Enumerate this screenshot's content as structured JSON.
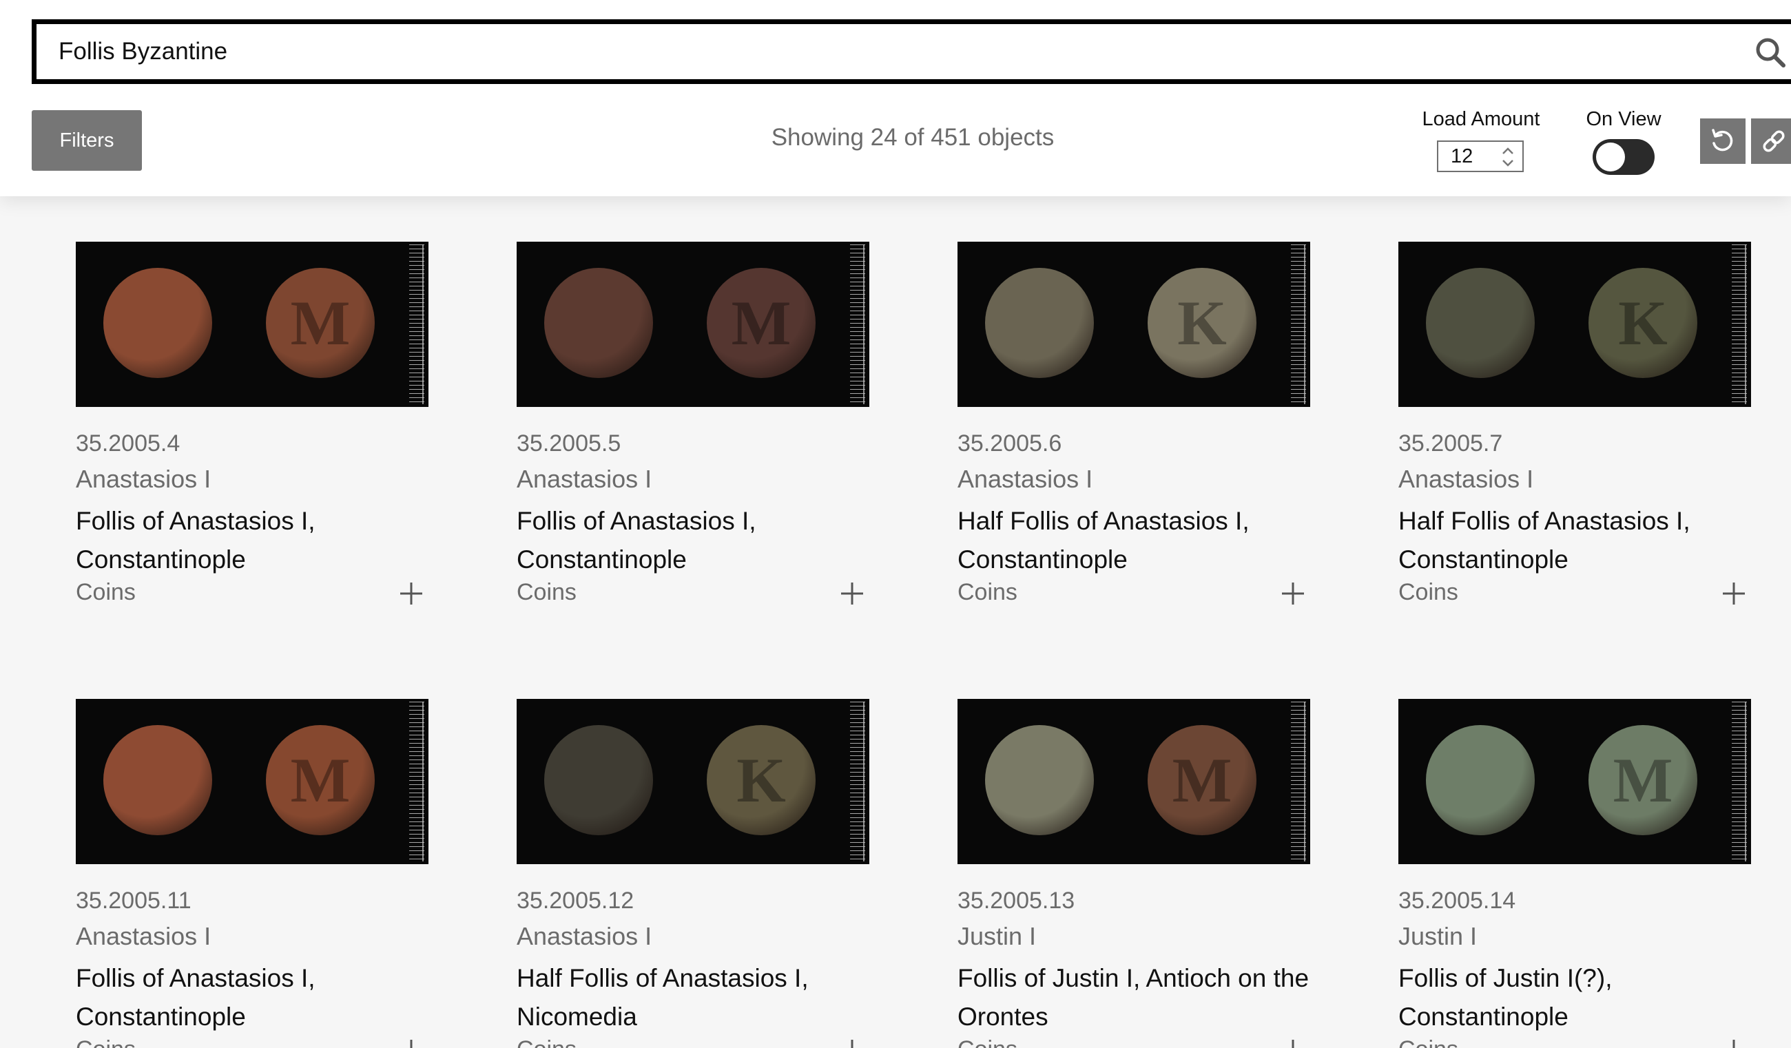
{
  "search": {
    "value": "Follis Byzantine"
  },
  "toolbar": {
    "filters_label": "Filters",
    "showing_text": "Showing 24 of 451 objects",
    "load_amount_label": "Load Amount",
    "load_amount_value": "12",
    "on_view_label": "On View",
    "on_view_enabled": false
  },
  "colors": {
    "button_gray": "#767676",
    "muted_text": "#6b6b6b",
    "toggle_track": "#2a2a2a"
  },
  "objects": [
    {
      "accession": "35.2005.4",
      "maker": "Anastasios I",
      "title": "Follis of Anastasios I, Constantinople",
      "category": "Coins"
    },
    {
      "accession": "35.2005.5",
      "maker": "Anastasios I",
      "title": "Follis of Anastasios I, Constantinople",
      "category": "Coins"
    },
    {
      "accession": "35.2005.6",
      "maker": "Anastasios I",
      "title": "Half Follis of Anastasios I, Constantinople",
      "category": "Coins"
    },
    {
      "accession": "35.2005.7",
      "maker": "Anastasios I",
      "title": "Half Follis of Anastasios I, Constantinople",
      "category": "Coins"
    },
    {
      "accession": "35.2005.11",
      "maker": "Anastasios I",
      "title": "Follis of Anastasios I, Constantinople",
      "category": "Coins"
    },
    {
      "accession": "35.2005.12",
      "maker": "Anastasios I",
      "title": "Half Follis of Anastasios I, Nicomedia",
      "category": "Coins"
    },
    {
      "accession": "35.2005.13",
      "maker": "Justin I",
      "title": "Follis of Justin I, Antioch on the Orontes",
      "category": "Coins"
    },
    {
      "accession": "35.2005.14",
      "maker": "Justin I",
      "title": "Follis of Justin I(?), Constantinople",
      "category": "Coins"
    }
  ]
}
